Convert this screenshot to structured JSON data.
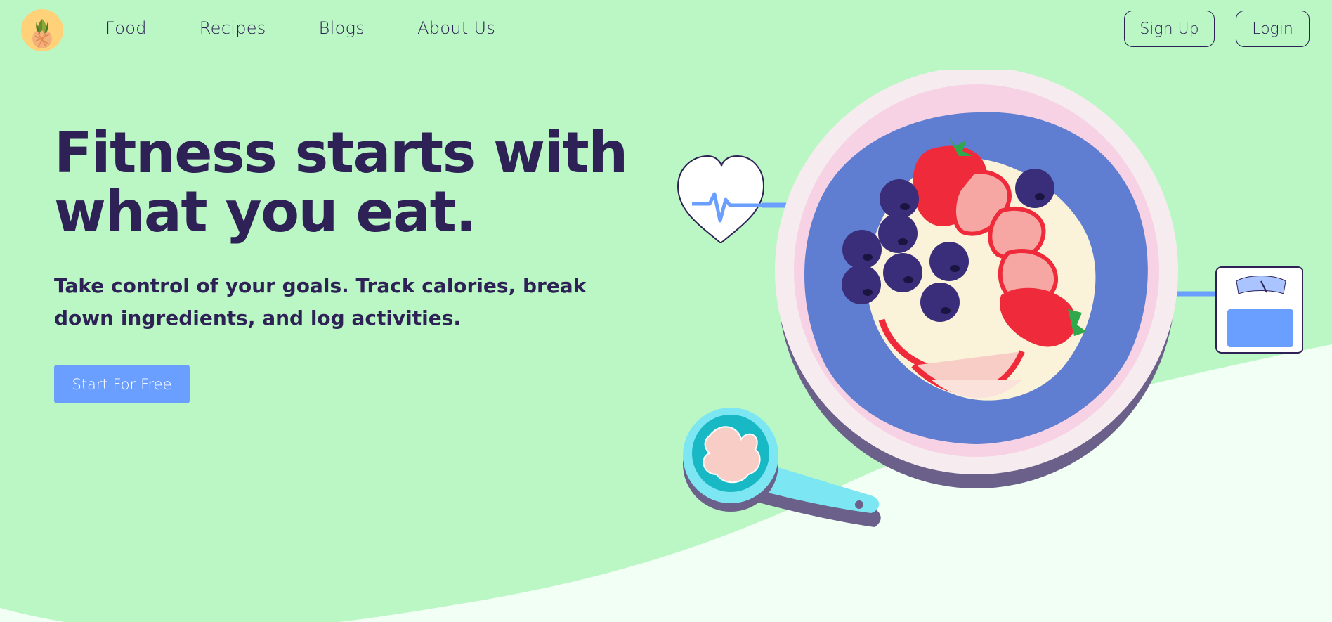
{
  "brand": {
    "logo_icon": "pineapple-icon",
    "colors": {
      "background": "#bbf7c4",
      "text": "#2d2155",
      "primary": "#6a9eff",
      "logo_bg": "#ffd27a"
    }
  },
  "nav": {
    "items": [
      {
        "label": "Food"
      },
      {
        "label": "Recipes"
      },
      {
        "label": "Blogs"
      },
      {
        "label": "About Us"
      }
    ],
    "signup_label": "Sign Up",
    "login_label": "Login"
  },
  "hero": {
    "title_line1": "Fitness starts with",
    "title_line2": "what you eat.",
    "subtitle_line1": "Take control of your goals. Track calories, break",
    "subtitle_line2": "down ingredients, and log activities.",
    "cta_label": "Start For Free"
  },
  "illustration": {
    "icons": [
      "heart-rate-icon",
      "bowl-icon",
      "scale-icon",
      "measuring-spoon-icon",
      "strawberry-icon",
      "blueberry-icon"
    ]
  }
}
